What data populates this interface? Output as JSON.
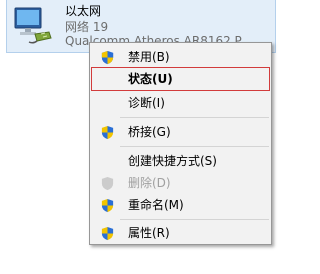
{
  "adapter": {
    "name": "以太网",
    "status": "网络  19",
    "device": "Qualcomm Atheros AR8162 P",
    "icon": "network-adapter-icon"
  },
  "menu": {
    "items": [
      {
        "label": "禁用(B)",
        "icon": "uac-shield-icon"
      },
      {
        "label": "状态(U)"
      },
      {
        "label": "诊断(I)"
      },
      {
        "label": "桥接(G)",
        "icon": "uac-shield-icon"
      },
      {
        "label": "创建快捷方式(S)"
      },
      {
        "label": "删除(D)",
        "icon": "uac-shield-icon"
      },
      {
        "label": "重命名(M)",
        "icon": "uac-shield-icon"
      },
      {
        "label": "属性(R)",
        "icon": "uac-shield-icon"
      }
    ]
  },
  "colors": {
    "selection_bg": "#e3eef9",
    "highlight_border": "#d23b3b",
    "menu_bg": "#f2f2f2",
    "disabled_text": "#a0a0a0"
  }
}
